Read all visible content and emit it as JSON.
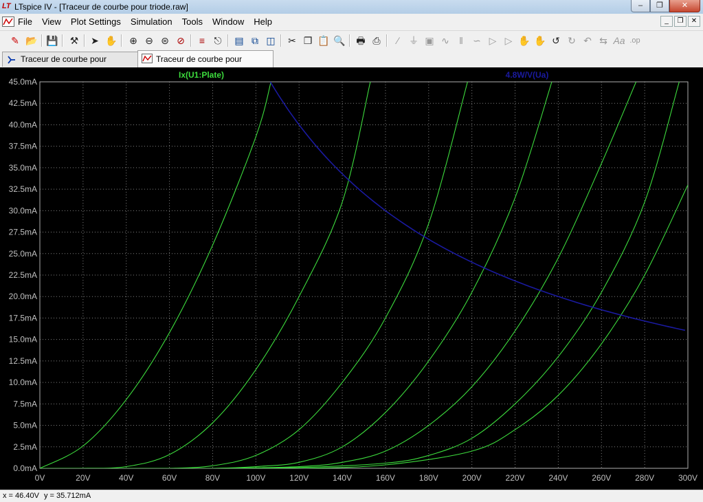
{
  "window": {
    "title": "LTspice IV - [Traceur de courbe pour triode.raw]",
    "app_logo": "LT"
  },
  "menu": [
    "File",
    "View",
    "Plot Settings",
    "Simulation",
    "Tools",
    "Window",
    "Help"
  ],
  "toolbar_icons": [
    "new-schematic-icon",
    "open-icon",
    "save-icon",
    "control-panel-icon",
    "run-icon",
    "halt-icon",
    "zoom-in-icon",
    "zoom-out-icon",
    "zoom-fit-icon",
    "zoom-cancel-icon",
    "autorange-icon",
    "annotate-icon",
    "tile-horizontal-icon",
    "cascade-icon",
    "tile-vertical-icon",
    "cut-icon",
    "copy-icon",
    "paste-icon",
    "find-icon",
    "print-preview-icon",
    "print-icon",
    "wire-icon",
    "ground-icon",
    "label-net-icon",
    "resistor-icon",
    "capacitor-icon",
    "inductor-icon",
    "diode-icon",
    "component-icon",
    "move-icon",
    "drag-icon",
    "undo-icon",
    "redo-icon",
    "rotate-icon",
    "mirror-icon",
    "text-icon",
    "spice-directive-icon"
  ],
  "tabs": [
    {
      "label": "Traceur de courbe pour triode.asc",
      "icon": "schematic-icon"
    },
    {
      "label": "Traceur de courbe pour triode.raw",
      "icon": "waveform-icon"
    }
  ],
  "status": {
    "x": "x = 46.40V",
    "y": "y = 35.712mA"
  },
  "colors": {
    "plot_bg": "#000000",
    "grid": "#808080",
    "trace_green": "#3ddc3d",
    "trace_blue": "#1a1aa0",
    "axis_text": "#c0c0c0"
  },
  "chart_data": {
    "type": "line",
    "series_labels": [
      "Ix(U1:Plate)",
      "4.8W/V(Ua)"
    ],
    "xlim": [
      0,
      300
    ],
    "ylim": [
      0,
      45
    ],
    "x_ticks": [
      "0V",
      "20V",
      "40V",
      "60V",
      "80V",
      "100V",
      "120V",
      "140V",
      "160V",
      "180V",
      "200V",
      "220V",
      "240V",
      "260V",
      "280V",
      "300V"
    ],
    "y_ticks": [
      "0.0mA",
      "2.5mA",
      "5.0mA",
      "7.5mA",
      "10.0mA",
      "12.5mA",
      "15.0mA",
      "17.5mA",
      "20.0mA",
      "22.5mA",
      "25.0mA",
      "27.5mA",
      "30.0mA",
      "32.5mA",
      "35.0mA",
      "37.5mA",
      "40.0mA",
      "42.5mA",
      "45.0mA"
    ],
    "series": [
      {
        "name": "Ix(U1:Plate)",
        "color": "#3ddc3d",
        "x": [
          0,
          20,
          40,
          60,
          80,
          100,
          107
        ],
        "y": [
          0,
          2.6,
          8.0,
          15.8,
          26.0,
          38.6,
          45
        ]
      },
      {
        "color": "#3ddc3d",
        "x": [
          0,
          20,
          40,
          60,
          80,
          100,
          120,
          140,
          153
        ],
        "y": [
          0,
          0,
          0.2,
          1.6,
          5.3,
          11.5,
          20.0,
          31.0,
          45
        ]
      },
      {
        "color": "#3ddc3d",
        "x": [
          0,
          20,
          40,
          60,
          80,
          100,
          120,
          140,
          160,
          180,
          198
        ],
        "y": [
          0,
          0,
          0,
          0,
          0.3,
          1.5,
          4.5,
          10.0,
          17.5,
          28.5,
          45
        ]
      },
      {
        "color": "#3ddc3d",
        "x": [
          0,
          40,
          80,
          100,
          120,
          140,
          160,
          180,
          200,
          220,
          237
        ],
        "y": [
          0,
          0,
          0,
          0.2,
          0.7,
          2.5,
          6.5,
          12.5,
          20.5,
          31.5,
          45
        ]
      },
      {
        "color": "#3ddc3d",
        "x": [
          0,
          40,
          80,
          120,
          140,
          160,
          180,
          200,
          220,
          240,
          260,
          276
        ],
        "y": [
          0,
          0,
          0,
          0.2,
          0.7,
          2.0,
          5.0,
          9.5,
          16.0,
          24.5,
          35.5,
          45
        ]
      },
      {
        "color": "#3ddc3d",
        "x": [
          0,
          40,
          80,
          120,
          160,
          180,
          200,
          220,
          240,
          260,
          280,
          296
        ],
        "y": [
          0,
          0,
          0,
          0.1,
          0.6,
          1.5,
          3.5,
          7.5,
          13.0,
          20.5,
          31.0,
          45
        ]
      },
      {
        "color": "#3ddc3d",
        "x": [
          0,
          40,
          80,
          120,
          160,
          200,
          220,
          240,
          260,
          280,
          300
        ],
        "y": [
          0,
          0,
          0,
          0,
          0.4,
          2.0,
          4.5,
          8.5,
          14.5,
          22.5,
          33.0
        ]
      },
      {
        "name": "4.8W/V(Ua)",
        "color": "#1a1aa0",
        "fn": "4.8/x",
        "x_from": 106.7,
        "x_to": 300
      }
    ]
  }
}
